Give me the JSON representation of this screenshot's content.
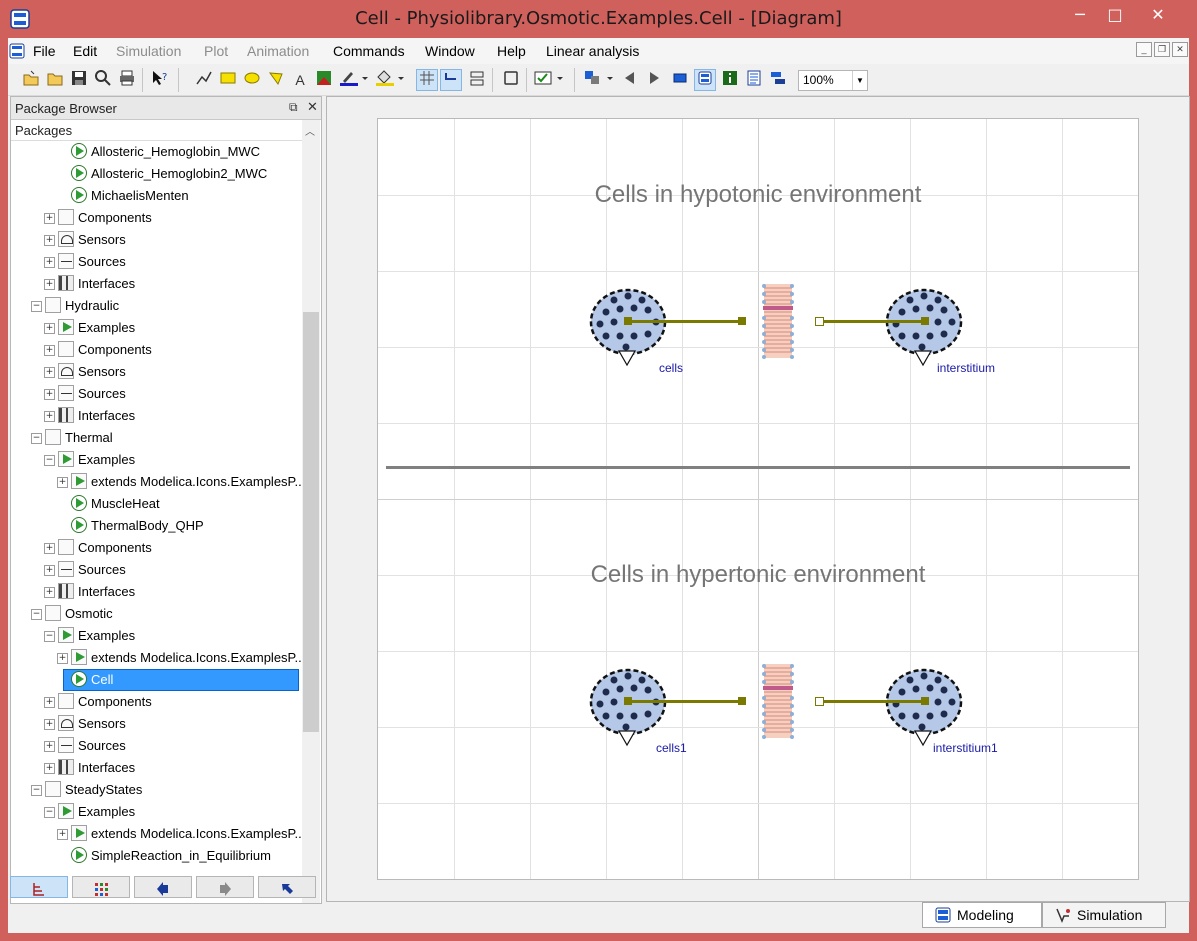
{
  "window": {
    "title": "Cell - Physiolibrary.Osmotic.Examples.Cell  - [Diagram]",
    "minimize_glyph": "─",
    "maximize_glyph": "□",
    "close_glyph": "✕"
  },
  "menu": [
    {
      "label": "File",
      "enabled": true
    },
    {
      "label": "Edit",
      "enabled": true
    },
    {
      "label": "Simulation",
      "enabled": false
    },
    {
      "label": "Plot",
      "enabled": false
    },
    {
      "label": "Animation",
      "enabled": false
    },
    {
      "label": "Commands",
      "enabled": true
    },
    {
      "label": "Window",
      "enabled": true
    },
    {
      "label": "Help",
      "enabled": true
    },
    {
      "label": "Linear analysis",
      "enabled": true
    }
  ],
  "toolbar": {
    "zoom": "100%",
    "text_tool_glyph": "A"
  },
  "package_browser": {
    "title": "Package Browser",
    "packages_label": "Packages",
    "rows": [
      {
        "level": 4,
        "icon": "play",
        "label": "Allosteric_Hemoglobin_MWC",
        "expander": ""
      },
      {
        "level": 4,
        "icon": "play",
        "label": "Allosteric_Hemoglobin2_MWC",
        "expander": ""
      },
      {
        "level": 4,
        "icon": "play",
        "label": "MichaelisMenten",
        "expander": ""
      },
      {
        "level": 3,
        "icon": "box",
        "label": "Components",
        "expander": "+"
      },
      {
        "level": 3,
        "icon": "sensor",
        "label": "Sensors",
        "expander": "+"
      },
      {
        "level": 3,
        "icon": "source",
        "label": "Sources",
        "expander": "+"
      },
      {
        "level": 3,
        "icon": "interface",
        "label": "Interfaces",
        "expander": "+"
      },
      {
        "level": 2,
        "icon": "box",
        "label": "Hydraulic",
        "expander": "-"
      },
      {
        "level": 3,
        "icon": "examples",
        "label": "Examples",
        "expander": "+"
      },
      {
        "level": 3,
        "icon": "box",
        "label": "Components",
        "expander": "+"
      },
      {
        "level": 3,
        "icon": "sensor",
        "label": "Sensors",
        "expander": "+"
      },
      {
        "level": 3,
        "icon": "source",
        "label": "Sources",
        "expander": "+"
      },
      {
        "level": 3,
        "icon": "interface",
        "label": "Interfaces",
        "expander": "+"
      },
      {
        "level": 2,
        "icon": "box",
        "label": "Thermal",
        "expander": "-"
      },
      {
        "level": 3,
        "icon": "examples",
        "label": "Examples",
        "expander": "-"
      },
      {
        "level": 4,
        "icon": "examples",
        "label": "extends Modelica.Icons.ExamplesP...",
        "expander": "+"
      },
      {
        "level": 4,
        "icon": "play",
        "label": "MuscleHeat",
        "expander": ""
      },
      {
        "level": 4,
        "icon": "play",
        "label": "ThermalBody_QHP",
        "expander": ""
      },
      {
        "level": 3,
        "icon": "box",
        "label": "Components",
        "expander": "+"
      },
      {
        "level": 3,
        "icon": "source",
        "label": "Sources",
        "expander": "+"
      },
      {
        "level": 3,
        "icon": "interface",
        "label": "Interfaces",
        "expander": "+"
      },
      {
        "level": 2,
        "icon": "box",
        "label": "Osmotic",
        "expander": "-"
      },
      {
        "level": 3,
        "icon": "examples",
        "label": "Examples",
        "expander": "-"
      },
      {
        "level": 4,
        "icon": "examples",
        "label": "extends Modelica.Icons.ExamplesP...",
        "expander": "+"
      },
      {
        "level": 4,
        "icon": "play",
        "label": "Cell",
        "expander": "",
        "selected": true
      },
      {
        "level": 3,
        "icon": "box",
        "label": "Components",
        "expander": "+"
      },
      {
        "level": 3,
        "icon": "sensor",
        "label": "Sensors",
        "expander": "+"
      },
      {
        "level": 3,
        "icon": "source",
        "label": "Sources",
        "expander": "+"
      },
      {
        "level": 3,
        "icon": "interface",
        "label": "Interfaces",
        "expander": "+"
      },
      {
        "level": 2,
        "icon": "box",
        "label": "SteadyStates",
        "expander": "-"
      },
      {
        "level": 3,
        "icon": "examples",
        "label": "Examples",
        "expander": "-"
      },
      {
        "level": 4,
        "icon": "examples",
        "label": "extends Modelica.Icons.ExamplesP...",
        "expander": "+"
      },
      {
        "level": 4,
        "icon": "play",
        "label": "SimpleReaction_in_Equilibrium",
        "expander": ""
      }
    ]
  },
  "diagram": {
    "title_top": "Cells in hypotonic environment",
    "title_bottom": "Cells in hypertonic environment",
    "labels": {
      "cells": "cells",
      "interstitium": "interstitium",
      "cells1": "cells1",
      "interstitium1": "interstitium1"
    },
    "colors": {
      "connector_line": "#7a7a00",
      "cell_fill": "#b5c8e8",
      "dots": "#1f2b4d",
      "separator": "#808080",
      "membrane_band": "#c05a8a"
    }
  },
  "bottom_tabs": [
    {
      "label": "Modeling",
      "active": true
    },
    {
      "label": "Simulation",
      "active": false
    }
  ]
}
